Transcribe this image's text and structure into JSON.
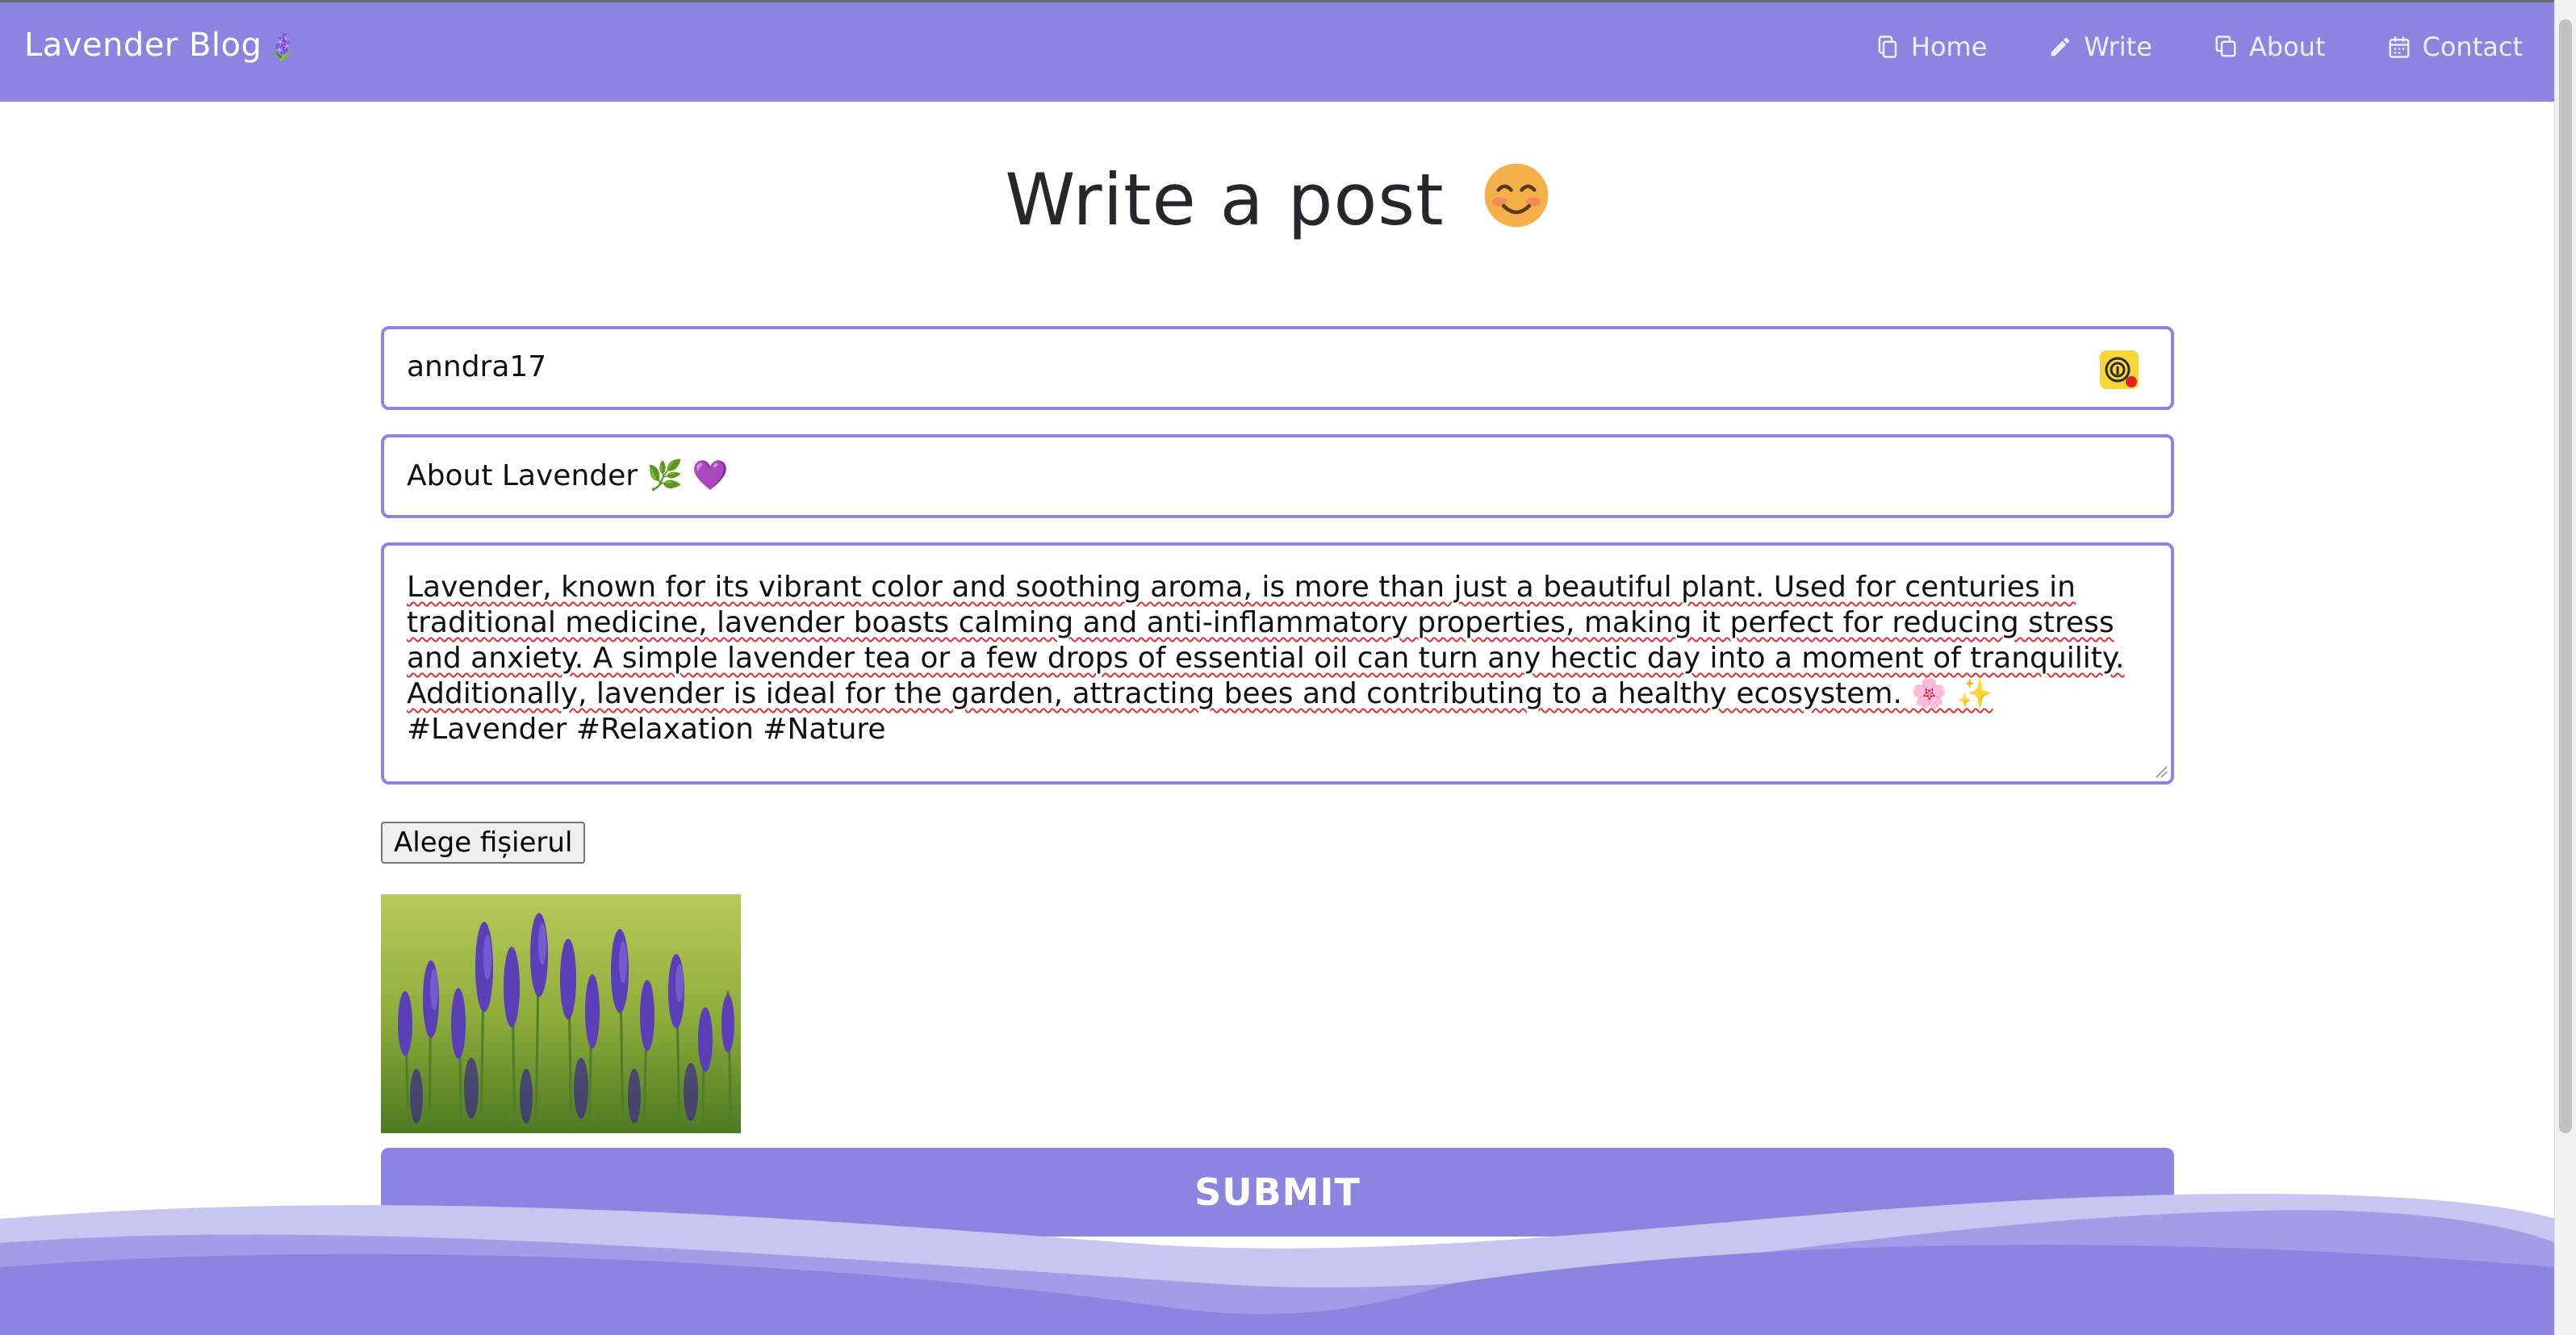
{
  "nav": {
    "brand": "Lavender Blog",
    "brand_emoji": "🪻",
    "items": [
      {
        "label": "Home",
        "icon": "copy-icon"
      },
      {
        "label": "Write",
        "icon": "pencil-icon"
      },
      {
        "label": "About",
        "icon": "copy-icon"
      },
      {
        "label": "Contact",
        "icon": "calendar-icon"
      }
    ]
  },
  "page": {
    "title": "Write a post"
  },
  "form": {
    "author_value": "anndra17",
    "title_value": "About Lavender 🌿 💜",
    "body_lines": [
      "Lavender, known for its vibrant color and soothing aroma, is more than just a beautiful plant. Used for centuries in",
      "traditional medicine, lavender boasts calming and anti-inflammatory properties, making it perfect for reducing stress",
      "and anxiety. A simple lavender tea or a few drops of essential oil can turn any hectic day into a moment of tranquility.",
      "Additionally, lavender is ideal for the garden, attracting bees and contributing to a healthy ecosystem. 🌸 ✨",
      "#Lavender #Relaxation #Nature"
    ],
    "file_button_label": "Alege fișierul",
    "submit_label": "SUBMIT"
  },
  "colors": {
    "accent": "#8b84e1",
    "text": "#26262b"
  }
}
